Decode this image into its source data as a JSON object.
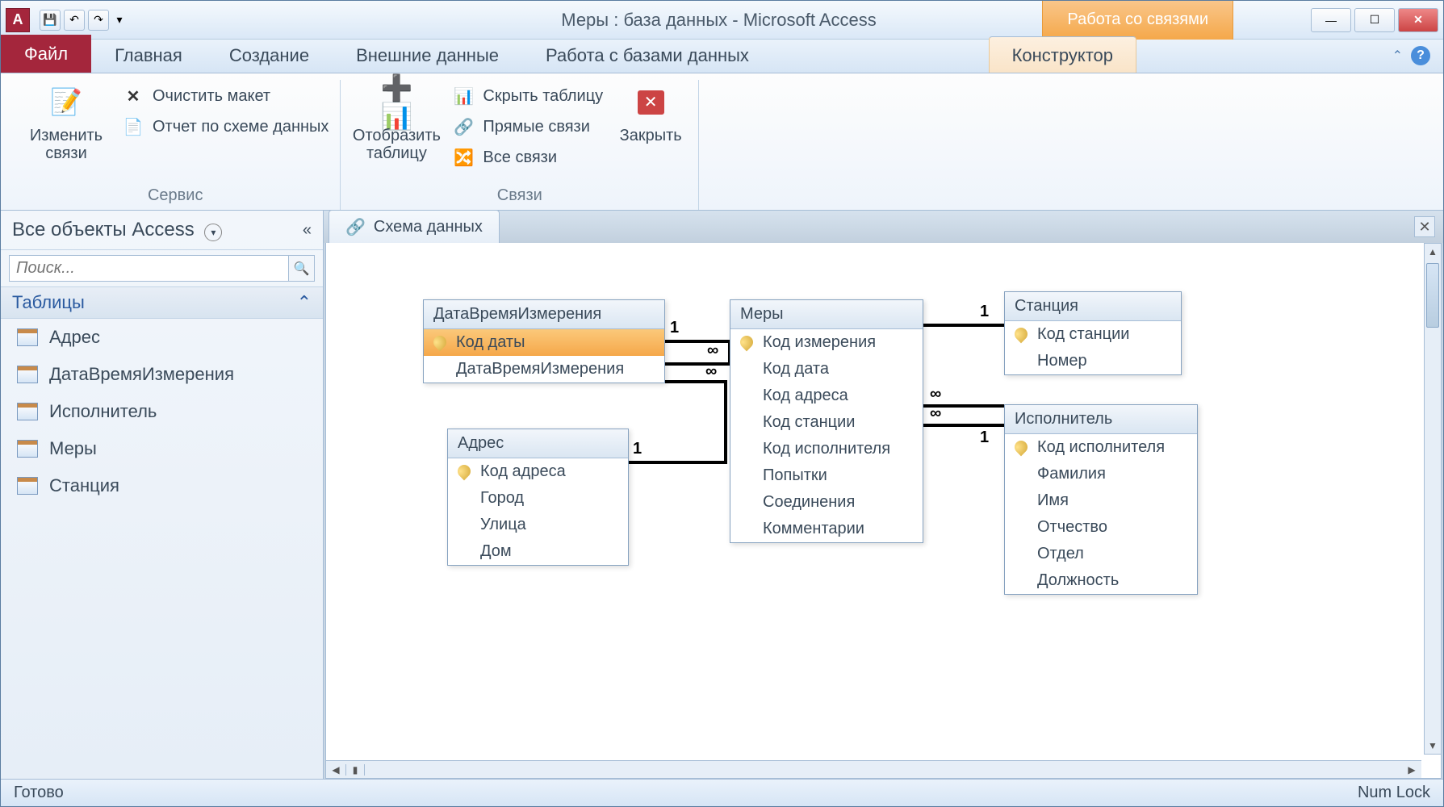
{
  "title": "Меры : база данных  -  Microsoft Access",
  "contextual_tab_group": "Работа со связями",
  "ribbon": {
    "tabs": {
      "file": "Файл",
      "home": "Главная",
      "create": "Создание",
      "external": "Внешние данные",
      "dbwork": "Работа с базами данных",
      "designer": "Конструктор"
    },
    "groups": {
      "service": "Сервис",
      "relations": "Связи"
    },
    "buttons": {
      "edit_relations": "Изменить связи",
      "clear_layout": "Очистить макет",
      "schema_report": "Отчет по схеме данных",
      "show_table": "Отобразить таблицу",
      "hide_table": "Скрыть таблицу",
      "direct_relations": "Прямые связи",
      "all_relations": "Все связи",
      "close": "Закрыть"
    }
  },
  "nav": {
    "header": "Все объекты Access",
    "search_placeholder": "Поиск...",
    "section": "Таблицы",
    "tables": [
      "Адрес",
      "ДатаВремяИзмерения",
      "Исполнитель",
      "Меры",
      "Станция"
    ]
  },
  "doc_tab": "Схема данных",
  "tables": {
    "datavremya": {
      "title": "ДатаВремяИзмерения",
      "fields": [
        "Код даты",
        "ДатаВремяИзмерения"
      ],
      "pk": [
        0
      ]
    },
    "mery": {
      "title": "Меры",
      "fields": [
        "Код измерения",
        "Код дата",
        "Код адреса",
        "Код станции",
        "Код исполнителя",
        "Попытки",
        "Соединения",
        "Комментарии"
      ],
      "pk": [
        0
      ]
    },
    "stanciya": {
      "title": "Станция",
      "fields": [
        "Код станции",
        "Номер"
      ],
      "pk": [
        0
      ]
    },
    "adres": {
      "title": "Адрес",
      "fields": [
        "Код адреса",
        "Город",
        "Улица",
        "Дом"
      ],
      "pk": [
        0
      ]
    },
    "ispolnitel": {
      "title": "Исполнитель",
      "fields": [
        "Код исполнителя",
        "Фамилия",
        "Имя",
        "Отчество",
        "Отдел",
        "Должность"
      ],
      "pk": [
        0
      ]
    }
  },
  "rel_labels": {
    "one": "1",
    "many": "∞"
  },
  "status": {
    "ready": "Готово",
    "numlock": "Num Lock"
  }
}
